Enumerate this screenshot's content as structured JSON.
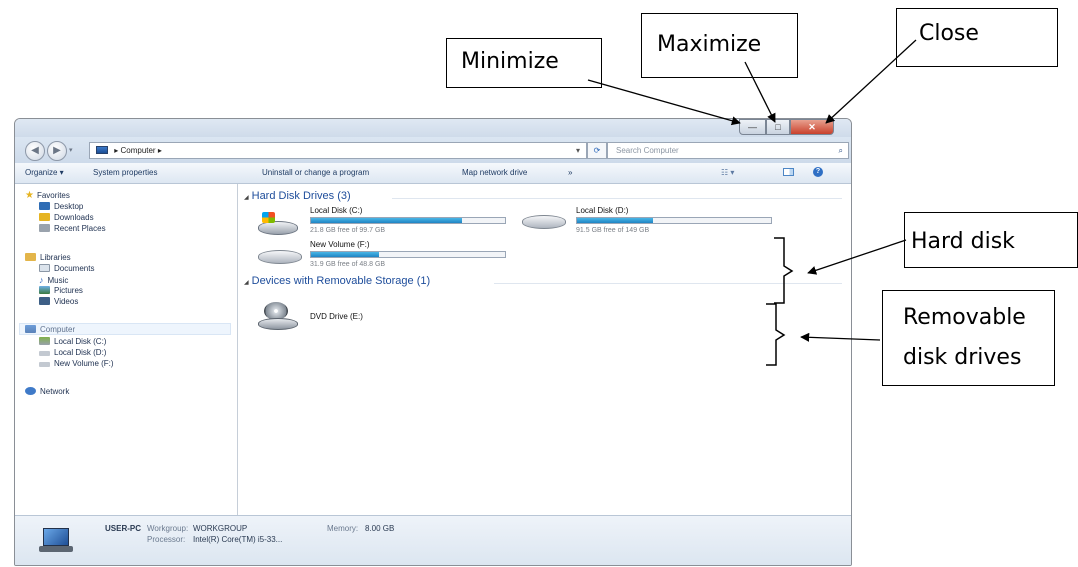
{
  "callouts": {
    "minimize": "Minimize",
    "maximize": "Maximize",
    "close": "Close",
    "hard_disk": "Hard disk",
    "removable_line1": "Removable",
    "removable_line2": "disk drives"
  },
  "window": {
    "caption_buttons": {
      "minimize": "—",
      "maximize": "□",
      "close": "✕"
    },
    "address": {
      "icon": "computer-icon",
      "path": "▸ Computer ▸"
    },
    "search_placeholder": "Search Computer",
    "toolbar": {
      "organize": "Organize ▾",
      "system_properties": "System properties",
      "uninstall": "Uninstall or change a program",
      "map_drive": "Map network drive",
      "more": "»"
    },
    "nav": {
      "favorites": "Favorites",
      "desktop": "Desktop",
      "downloads": "Downloads",
      "recent": "Recent Places",
      "libraries": "Libraries",
      "documents": "Documents",
      "music": "Music",
      "pictures": "Pictures",
      "videos": "Videos",
      "computer": "Computer",
      "local_c": "Local Disk (C:)",
      "local_d": "Local Disk (D:)",
      "new_volume": "New Volume (F:)",
      "network": "Network"
    },
    "groups": {
      "hard_disks": "Hard Disk Drives (3)",
      "removable": "Devices with Removable Storage (1)"
    },
    "drives": [
      {
        "name": "Local Disk (C:)",
        "free": "21.8 GB free of 99.7 GB",
        "used_fraction": 0.78
      },
      {
        "name": "Local Disk (D:)",
        "free": "91.5 GB free of 149 GB",
        "used_fraction": 0.39
      },
      {
        "name": "New Volume (F:)",
        "free": "31.9 GB free of 48.8 GB",
        "used_fraction": 0.35
      }
    ],
    "dvd": {
      "name": "DVD Drive (E:)"
    },
    "details": {
      "pc_name": "USER-PC",
      "workgroup_label": "Workgroup:",
      "workgroup": "WORKGROUP",
      "memory_label": "Memory:",
      "memory": "8.00 GB",
      "processor_label": "Processor:",
      "processor": "Intel(R) Core(TM) i5-33..."
    }
  }
}
